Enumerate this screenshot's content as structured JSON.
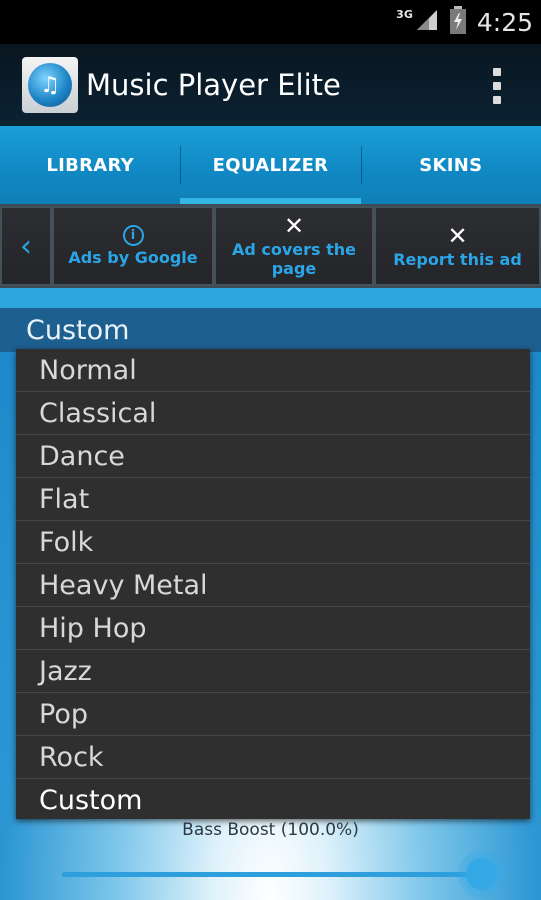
{
  "status_bar": {
    "network": "3G",
    "time": "4:25"
  },
  "action_bar": {
    "title": "Music Player Elite"
  },
  "tabs": [
    {
      "label": "LIBRARY"
    },
    {
      "label": "EQUALIZER"
    },
    {
      "label": "SKINS"
    }
  ],
  "ad_bar": {
    "back": "‹",
    "ads_by_google": "Ads by Google",
    "ad_covers_page": "Ad covers the page",
    "report_ad": "Report this ad",
    "close_glyph": "✕",
    "info_glyph": "i"
  },
  "preset": {
    "current": "Custom",
    "options": [
      "Normal",
      "Classical",
      "Dance",
      "Flat",
      "Folk",
      "Heavy Metal",
      "Hip Hop",
      "Jazz",
      "Pop",
      "Rock",
      "Custom"
    ]
  },
  "bass_boost": {
    "label": "Bass Boost (100.0%)",
    "value_percent": 100
  },
  "colors": {
    "accent": "#33b5e5",
    "ad_text": "#2aa6e8",
    "dropdown_bg": "#2f2f2f"
  }
}
